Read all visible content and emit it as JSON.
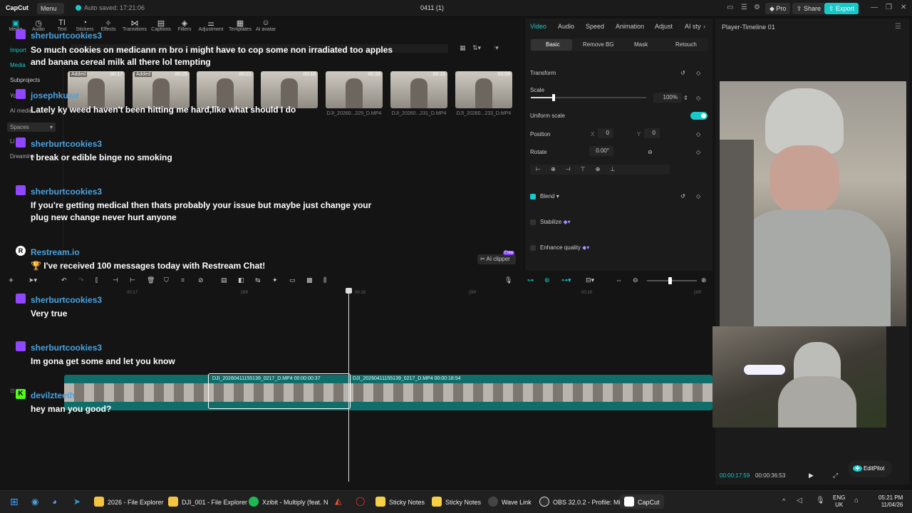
{
  "titlebar": {
    "logo": "CapCut",
    "menu": "Menu",
    "autosave": "Auto saved: 17:21:06",
    "project": "0411 (1)",
    "pro": "Pro",
    "share": "Share",
    "export": "Export"
  },
  "toolbar": {
    "items": [
      "Media",
      "Audio",
      "Text",
      "Stickers",
      "Effects",
      "Transitions",
      "Captions",
      "Filters",
      "Adjustment",
      "Templates",
      "AI avatar"
    ]
  },
  "leftnav": {
    "items": [
      "Import",
      "Media",
      "Subprojects",
      "Yo",
      "AI media",
      "Spaces",
      "Li",
      "Dreamina"
    ]
  },
  "media": {
    "thumbs": [
      {
        "dur": "00:17",
        "added": "Added",
        "name": ""
      },
      {
        "dur": "00:25",
        "added": "Added",
        "name": ""
      },
      {
        "dur": "00:21",
        "added": "",
        "name": ""
      },
      {
        "dur": "00:18",
        "added": "",
        "name": ""
      },
      {
        "dur": "00:33",
        "added": "",
        "name": "DJI_20260...229_D.MP4"
      },
      {
        "dur": "00:15",
        "added": "",
        "name": "DJI_20260...231_D.MP4"
      },
      {
        "dur": "00:09",
        "added": "",
        "name": "DJI_20260...233_D.MP4"
      }
    ],
    "ai_clipper": "AI clipper",
    "free": "Free"
  },
  "chat": [
    {
      "user": "sherburtcookies3",
      "message": "So much cookies on medicann rn bro i might have to cop some non irradiated too apples and banana cereal milk all there lol tempting"
    },
    {
      "user": "josephkujur",
      "message": "Lately ky weed haven't been hitting me hard,like what should I do"
    },
    {
      "user": "sherburtcookies3",
      "message": "t break or edible binge no smoking"
    },
    {
      "user": "sherburtcookies3",
      "message": "If you're getting medical then thats probably your issue but maybe just change your plug new change never hurt anyone"
    },
    {
      "user": "Restream.io",
      "message": "🏆 I've received 100 messages today with Restream Chat!"
    },
    {
      "user": "sherburtcookies3",
      "message": "Very true"
    },
    {
      "user": "sherburtcookies3",
      "message": "Im gona get some and let you know"
    },
    {
      "user": "devilzteeth",
      "message": "hey man you good?"
    }
  ],
  "inspector": {
    "tabs": [
      "Video",
      "Audio",
      "Speed",
      "Animation",
      "Adjust",
      "AI sty"
    ],
    "subtabs": [
      "Basic",
      "Remove BG",
      "Mask",
      "Retouch"
    ],
    "transform": "Transform",
    "scale_label": "Scale",
    "scale_value": "100%",
    "uniform_scale": "Uniform scale",
    "position_label": "Position",
    "x_label": "X",
    "x_value": "0",
    "y_label": "Y",
    "y_value": "0",
    "rotate_label": "Rotate",
    "rotate_value": "0.00°",
    "blend": "Blend",
    "stabilize": "Stabilize",
    "enhance": "Enhance quality"
  },
  "player": {
    "title": "Player-Timeline 01",
    "current": "00:00:17:59",
    "total": "00:00:36:53",
    "editpilot": "EditPilot"
  },
  "timeline": {
    "ruler": [
      "00:17",
      "|30f",
      "00:18",
      "|30f",
      "00:19",
      "|30f"
    ],
    "clips": [
      {
        "name": "DJI_20260411155139_0217_D.MP4",
        "dur": "00:00:00:37"
      },
      {
        "name": "DJI_20260411155139_0217_D.MP4",
        "dur": "00:00:18:54"
      }
    ]
  },
  "taskbar": {
    "items": [
      "2026 - File Explorer",
      "DJI_001 - File Explorer",
      "Xzibit - Multiply (feat. N",
      "Sticky Notes",
      "Sticky Notes",
      "Wave Link",
      "OBS 32.0.2 - Profile: Mil",
      "CapCut"
    ],
    "lang": "ENG",
    "region": "UK",
    "time": "05:21 PM",
    "date": "11/04/26"
  },
  "colors": {
    "accent": "#19c9c9",
    "twitch": "#9146ff",
    "username": "#4aa3df"
  }
}
